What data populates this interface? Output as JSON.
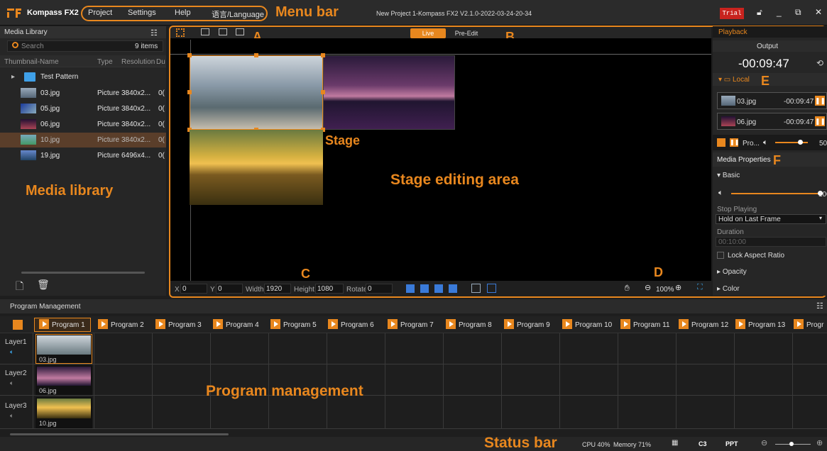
{
  "app": {
    "name": "Kompass FX2",
    "window_title": "New Project 1-Kompass FX2  V2.1.0-2022-03-24-20-34",
    "trial_label": "Trial"
  },
  "menu": {
    "items": [
      "Project",
      "Settings",
      "Help",
      "语言/Language"
    ]
  },
  "annotations": {
    "menu_bar": "Menu bar",
    "a": "A",
    "b": "B",
    "c": "C",
    "d": "D",
    "e": "E",
    "f": "F",
    "stage": "Stage",
    "stage_editing_area": "Stage editing area",
    "media_library": "Media library",
    "program_management": "Program management",
    "status_bar": "Status bar"
  },
  "media_library": {
    "title": "Media Library",
    "search_placeholder": "Search",
    "count": "9 items",
    "columns": [
      "Thumbnail-Name",
      "Type",
      "Resolution",
      "Du"
    ],
    "folder": "Test Pattern",
    "items": [
      {
        "name": "03.jpg",
        "type": "Picture",
        "res": "3840x2...",
        "dur": "0("
      },
      {
        "name": "05.jpg",
        "type": "Picture",
        "res": "3840x2...",
        "dur": "0("
      },
      {
        "name": "06.jpg",
        "type": "Picture",
        "res": "3840x2...",
        "dur": "0("
      },
      {
        "name": "10.jpg",
        "type": "Picture",
        "res": "3840x2...",
        "dur": "0("
      },
      {
        "name": "19.jpg",
        "type": "Picture",
        "res": "6496x4...",
        "dur": "0("
      }
    ]
  },
  "stage": {
    "tab_live": "Live",
    "tab_preedit": "Pre-Edit",
    "x_label": "X",
    "x": "0",
    "y_label": "Y",
    "y": "0",
    "width_label": "Width",
    "width": "1920",
    "height_label": "Height",
    "height": "1080",
    "rotate_label": "Rotate",
    "rotate": "0",
    "zoom": "100%"
  },
  "right_panel": {
    "tab": "Playback",
    "output_label": "Output",
    "output_time": "-00:09:47",
    "local_label": "Local",
    "playing": [
      {
        "name": "03.jpg",
        "time": "-00:09:47"
      },
      {
        "name": "06.jpg",
        "time": "-00:09:47"
      }
    ],
    "pro_label": "Pro...",
    "volume_val": "50",
    "media_properties": "Media Properties",
    "basic": "Basic",
    "basic_volume": "100",
    "stop_playing_label": "Stop Playing",
    "stop_playing_value": "Hold on Last Frame",
    "duration_label": "Duration",
    "duration_value": "00:10:00",
    "lock_aspect": "Lock Aspect Ratio",
    "opacity": "Opacity",
    "color": "Color"
  },
  "program_management": {
    "title": "Program Management",
    "programs": [
      "Program 1",
      "Program 2",
      "Program 3",
      "Program 4",
      "Program 5",
      "Program 6",
      "Program 7",
      "Program 8",
      "Program 9",
      "Program 10",
      "Program 11",
      "Program 12",
      "Program 13",
      "Progr"
    ],
    "layers": [
      {
        "name": "Layer1",
        "clip": "03.jpg"
      },
      {
        "name": "Layer2",
        "clip": "06.jpg"
      },
      {
        "name": "Layer3",
        "clip": "10.jpg"
      }
    ]
  },
  "status_bar": {
    "cpu": "CPU 40%",
    "memory": "Memory 71%",
    "c3": "C3",
    "ppt": "PPT"
  },
  "colors": {
    "accent": "#e8871e",
    "background": "#1e1e1e",
    "panel": "#262626"
  }
}
